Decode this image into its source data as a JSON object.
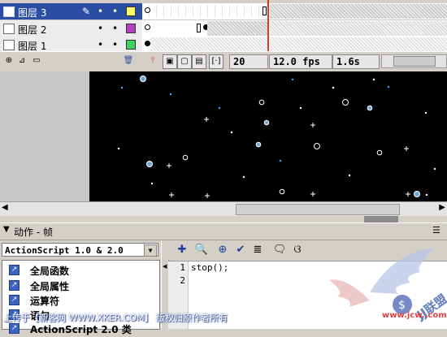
{
  "timeline": {
    "layers": [
      {
        "name": "图层 3",
        "selected": true,
        "color": "#ffff66"
      },
      {
        "name": "图层 2",
        "selected": false,
        "color": "#b040c0"
      },
      {
        "name": "图层 1",
        "selected": false,
        "color": "#40d060"
      }
    ],
    "current_frame": "20",
    "frame_rate": "12.0 fps",
    "elapsed": "1.6s"
  },
  "actions": {
    "panel_title": "动作 - 帧",
    "language": "ActionScript 1.0 & 2.0",
    "toolbox_items": [
      "全局函数",
      "全局属性",
      "运算符",
      "语句"
    ],
    "partial_item": "ActionScript 2.0 类",
    "line_numbers": [
      "1",
      "2"
    ],
    "code_lines": [
      "stop();",
      ""
    ]
  },
  "footer": {
    "upload_note": "上传于【新客网 WWW.XKER.COM】 版权归原作者所有",
    "watermark_url": "www.jcw..com"
  },
  "colors": {
    "selection": "#2b4ea2",
    "stage": "#000000",
    "playhead": "#e0342d"
  }
}
